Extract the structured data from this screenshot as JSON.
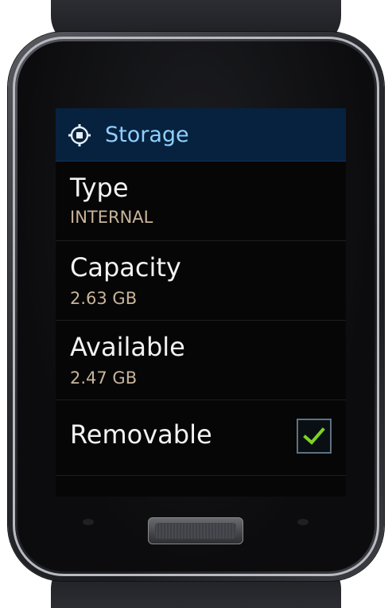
{
  "header": {
    "title": "Storage",
    "icon": "storage-chip-icon",
    "accent_color": "#8fd0ff",
    "background_color": "#07223f"
  },
  "items": [
    {
      "label": "Type",
      "value": "INTERNAL"
    },
    {
      "label": "Capacity",
      "value": "2.63 GB"
    },
    {
      "label": "Available",
      "value": "2.47 GB"
    },
    {
      "label": "Removable",
      "checked": true,
      "check_color": "#7ed321"
    }
  ],
  "value_color": "#c8b49a"
}
